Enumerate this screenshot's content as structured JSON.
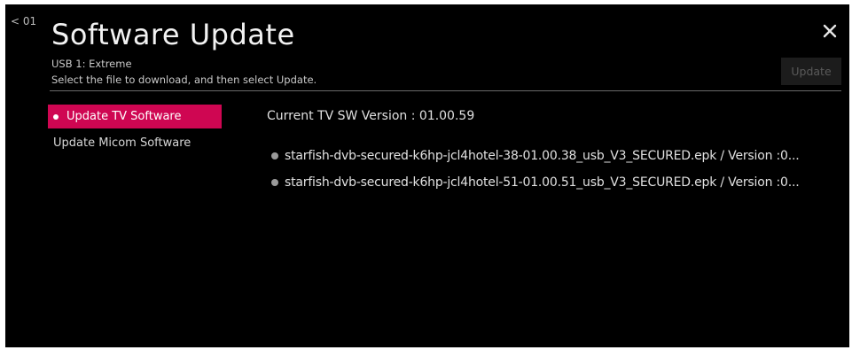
{
  "header": {
    "back_label": "< 01",
    "title": "Software Update",
    "source": "USB 1: Extreme",
    "instruction": "Select the file to download, and then select Update.",
    "update_label": "Update",
    "close_icon": "close-icon"
  },
  "sidebar": {
    "items": [
      {
        "label": "Update TV Software",
        "active": true
      },
      {
        "label": "Update Micom Software",
        "active": false
      }
    ]
  },
  "main": {
    "current_version": "Current TV SW Version : 01.00.59",
    "files": [
      {
        "label": "starfish-dvb-secured-k6hp-jcl4hotel-38-01.00.38_usb_V3_SECURED.epk / Version :0..."
      },
      {
        "label": "starfish-dvb-secured-k6hp-jcl4hotel-51-01.00.51_usb_V3_SECURED.epk / Version :0..."
      }
    ]
  },
  "colors": {
    "accent": "#cf0652",
    "background": "#000000",
    "disabled_button": "#1c1c1c"
  }
}
